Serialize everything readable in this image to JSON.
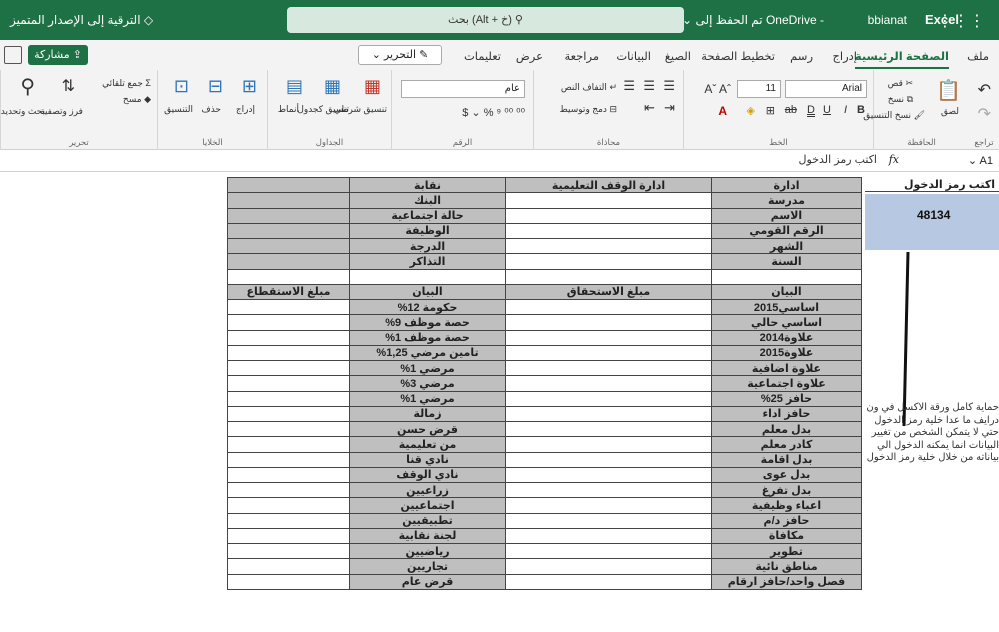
{
  "titlebar": {
    "app_name": "Excel",
    "user": "bbianat",
    "doc_status": "تم الحفظ إلى OneDrive",
    "search_placeholder": "بحث (Alt + خ)",
    "upgrade_label": "الترقية إلى الإصدار المتميز"
  },
  "tabs": [
    "ملف",
    "الصفحة الرئيسية",
    "إدراج",
    "رسم",
    "تخطيط الصفحة",
    "الصيغ",
    "البيانات",
    "مراجعة",
    "عرض",
    "تعليمات"
  ],
  "active_tab": "الصفحة الرئيسية",
  "toolbar": {
    "edit_mode": "التحرير",
    "share": "مشاركة"
  },
  "ribbon": {
    "undo_group": "تراجع",
    "clipboard": {
      "label": "الحافظة",
      "paste": "لصق",
      "cut": "قص",
      "copy": "نسخ",
      "format_painter": "نسخ التنسيق"
    },
    "font": {
      "label": "الخط",
      "name": "Arial",
      "size": "11"
    },
    "alignment": {
      "label": "محاذاة",
      "wrap": "التفاف النص",
      "merge": "دمج وتوسيط"
    },
    "number": {
      "label": "الرقم",
      "format": "عام"
    },
    "tables": {
      "label": "الجداول",
      "conditional": "تنسيق شرطي",
      "as_table": "تنسيق كجدول",
      "styles": "أنماط"
    },
    "cells": {
      "label": "الخلايا",
      "insert": "إدراج",
      "delete": "حذف",
      "format": "التنسيق"
    },
    "editing": {
      "label": "تحرير",
      "autosum": "جمع تلقائي",
      "clear": "مسح",
      "sort_filter": "فرز وتصفية",
      "find_select": "بحث وتحديد"
    }
  },
  "formula_bar": {
    "name_box": "A1",
    "content": "اكتب رمز الدخول"
  },
  "sheet": {
    "a1": "اكتب رمز الدخول",
    "a2": "48134",
    "note": "حماية كامل ورقة الاكسل في ون درايف ما عدا خلية رمز الدخول حتي لا يتمكن الشخص من تغيير البيانات انما يمكنه الدخول الي بياناته من خلال خلية رمز الدخول",
    "header_rows": [
      [
        "ادارة",
        "ادارة الوقف التعليمية",
        "نقابة",
        ""
      ],
      [
        "مدرسة",
        "",
        "البنك",
        ""
      ],
      [
        "الاسم",
        "",
        "حالة اجتماعية",
        ""
      ],
      [
        "الرقم القومي",
        "",
        "الوظيفة",
        ""
      ],
      [
        "الشهر",
        "",
        "الدرجة",
        ""
      ],
      [
        "السنة",
        "",
        "التذاكر",
        ""
      ]
    ],
    "columns": [
      "البيان",
      "مبلغ الاستحقاق",
      "البيان",
      "مبلغ الاستقطاع"
    ],
    "rows": [
      [
        "اساسي2015",
        "حكومة 12%"
      ],
      [
        "اساسي حالي",
        "حصة موظف 9%"
      ],
      [
        "علاوة2014",
        "حصة موظف 1%"
      ],
      [
        "علاوة2015",
        "تامين مرضي 1,25%"
      ],
      [
        "علاوة اضافية",
        "مرضي 1%"
      ],
      [
        "علاوة اجتماعية",
        "مرضي 3%"
      ],
      [
        "حافز 25%",
        "مرضي 1%"
      ],
      [
        "حافز اداء",
        "زمالة"
      ],
      [
        "بدل معلم",
        "قرض حسن"
      ],
      [
        "كادر معلم",
        "من تعليمية"
      ],
      [
        "بدل اقامة",
        "نادي قنا"
      ],
      [
        "بدل عوى",
        "نادي الوقف"
      ],
      [
        "بدل تفرغ",
        "زراعيين"
      ],
      [
        "اعباء وظيفية",
        "اجتماعيين"
      ],
      [
        "حافز د/م",
        "تطبيقيين"
      ],
      [
        "مكافاة",
        "لجنة نقابية"
      ],
      [
        "تطوير",
        "رياضيين"
      ],
      [
        "مناطق نائية",
        "تجاريين"
      ],
      [
        "فصل واحد/حافز ارقام",
        "قرض عام"
      ]
    ]
  }
}
